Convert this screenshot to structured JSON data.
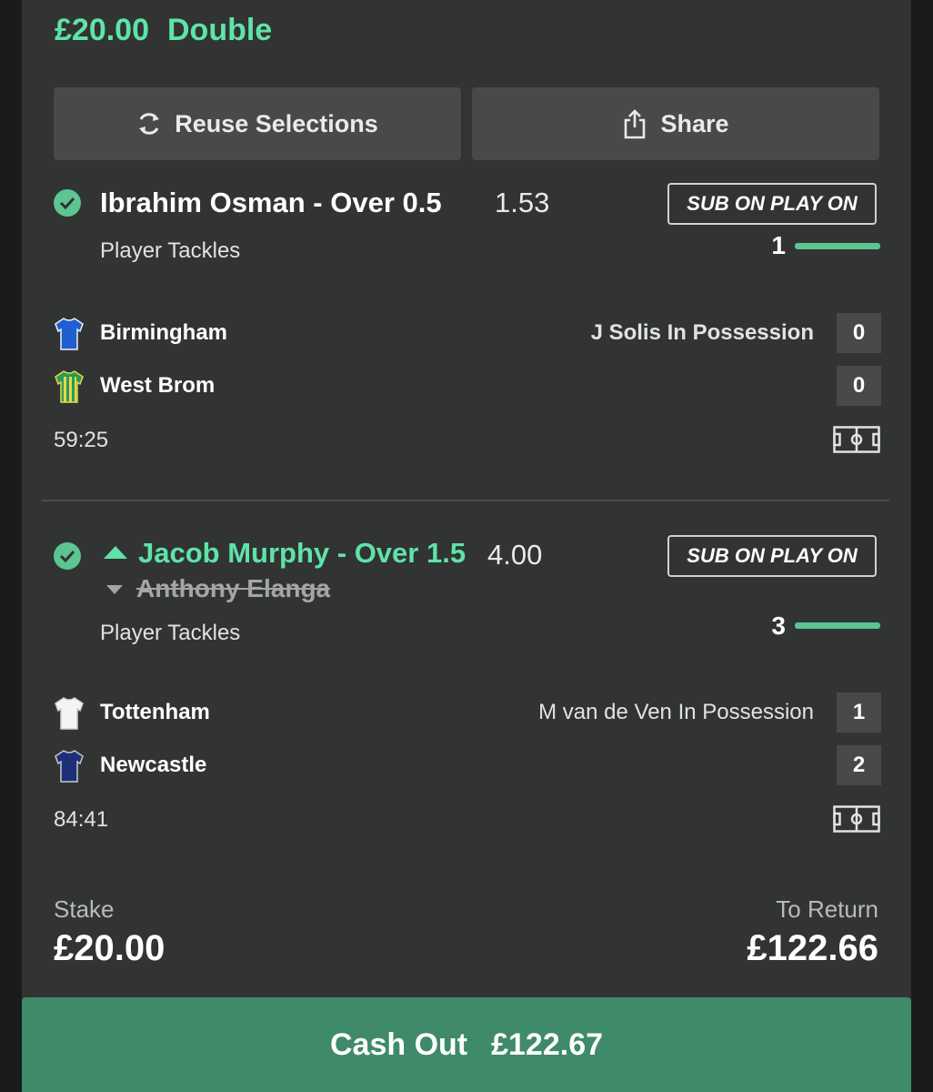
{
  "bet": {
    "stake_heading": "£20.00",
    "bet_type": "Double"
  },
  "actions": {
    "reuse_label": "Reuse Selections",
    "share_label": "Share"
  },
  "selections": [
    {
      "title": "Ibrahim Osman - Over 0.5",
      "odds": "1.53",
      "market": "Player Tackles",
      "badge": "SUB ON PLAY ON",
      "progress_value": "1",
      "progress_fraction": 1.0,
      "teams": [
        {
          "name": "Birmingham",
          "score": "0",
          "possession": "J Solis In Possession",
          "shirt": "blue-shirt-icon"
        },
        {
          "name": "West Brom",
          "score": "0",
          "possession": "",
          "shirt": "striped-shirt-icon"
        }
      ],
      "clock": "59:25"
    },
    {
      "title": "Jacob Murphy - Over 1.5",
      "odds": "4.00",
      "replaced": "Anthony Elanga",
      "market": "Player Tackles",
      "badge": "SUB ON PLAY ON",
      "progress_value": "3",
      "progress_fraction": 1.0,
      "teams": [
        {
          "name": "Tottenham",
          "score": "1",
          "possession": "M van de Ven In Possession",
          "shirt": "white-shirt-icon"
        },
        {
          "name": "Newcastle",
          "score": "2",
          "possession": "",
          "shirt": "navy-shirt-icon"
        }
      ],
      "clock": "84:41"
    }
  ],
  "summary": {
    "stake_label": "Stake",
    "stake_value": "£20.00",
    "return_label": "To Return",
    "return_value": "£122.66"
  },
  "cashout": {
    "label": "Cash Out",
    "value": "£122.67"
  },
  "colors": {
    "accent_green": "#5fe3a8",
    "card_bg": "#313433",
    "button_bg": "#474a49",
    "cashout_bg": "#3f8a69"
  }
}
